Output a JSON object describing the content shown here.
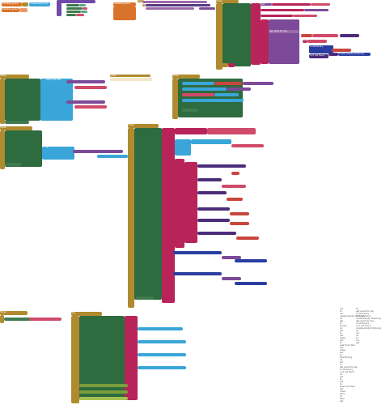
{
  "canvas": {
    "background": "#ffffff"
  },
  "colors": {
    "event": "#b08a2e",
    "procedure": "#d9732c",
    "component": "#2e6b3f",
    "variable": "#b8245a",
    "math": "#2a3ea0",
    "text": "#c9463d",
    "list": "#3aa5d8",
    "dictionary": "#7c4a99"
  },
  "blocks": {
    "b01": "initialize global",
    "b02": "create empty list",
    "b03": "initialize global",
    "b04": "when",
    "b05": "do",
    "b06": "set",
    "b07": "to",
    "b08": "call",
    "b09": "initialize global",
    "b10": "create empty dictionary",
    "b11": "when",
    "b12": "do",
    "b13": "set",
    "b14": "get",
    "b15": "to",
    "b16": "call",
    "b17": "get value for key",
    "b18": "in dictionary",
    "b19": "or if not found",
    "b20": "create empty dictionary",
    "b21": "when",
    "b22": "Screen",
    "b23": "do",
    "b24": "set",
    "b25": "to",
    "b26": "select list item",
    "b27": "list",
    "b28": "index",
    "b29": "set",
    "b30": "to",
    "b31": "select list item",
    "b32": "list",
    "b33": "index",
    "b34": "set",
    "b35": "to",
    "b36": "when",
    "b37": "AfterPicking",
    "b38": "do",
    "b39": "set",
    "b40": "to",
    "b41": "get value for key",
    "b42": "in dictionary",
    "b43": "or if not found",
    "b44": "when",
    "b45": "do",
    "b46": "set",
    "b47": "to",
    "b48": "set",
    "b49": "to",
    "b50": "select list item",
    "b51": "list",
    "b52": "index",
    "b53": "when",
    "b54": "Click",
    "b55": "do",
    "b56": "if",
    "b57": "then",
    "b58": "set",
    "b59": "to",
    "b60": "get value for key",
    "b61": "in dictionary",
    "b62": "or if not found",
    "b63": "create empty dictionary",
    "b64": "get value for key",
    "b65": "in dictionary",
    "b66": "or if not found",
    "b67": "create empty dictionary",
    "b68": "when",
    "b69": "do",
    "b70": "call",
    "b71": "when",
    "b72": "do",
    "b73": "set",
    "b74": "to",
    "b75": "call",
    "b76": "set"
  }
}
